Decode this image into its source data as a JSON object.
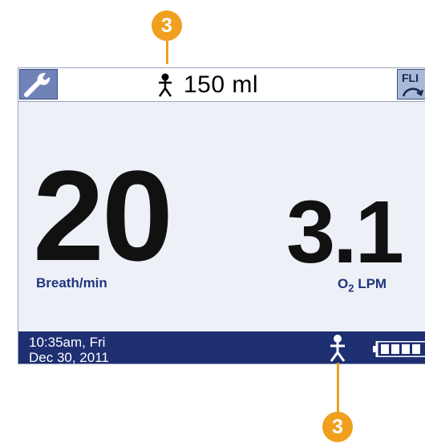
{
  "callouts": {
    "top": "3",
    "bottom": "3"
  },
  "topbar": {
    "wrench_icon": "wrench-icon",
    "volume": "150 ml",
    "flow_button_label": "FLI"
  },
  "main": {
    "breath_rate": "20",
    "breath_rate_unit": "Breath/min",
    "o2_flow": "3.1",
    "o2_unit_prefix": "O",
    "o2_unit_sub": "2",
    "o2_unit_suffix": " LPM"
  },
  "statusbar": {
    "time": "10:35am, Fri",
    "date": "Dec 30, 2011",
    "patient_icon": "person-icon",
    "battery_icon": "battery-icon"
  },
  "colors": {
    "callout": "#f0a01e",
    "status_bar": "#1e2f72",
    "accent_text": "#22347e",
    "screen_bg": "#edf1f7"
  }
}
